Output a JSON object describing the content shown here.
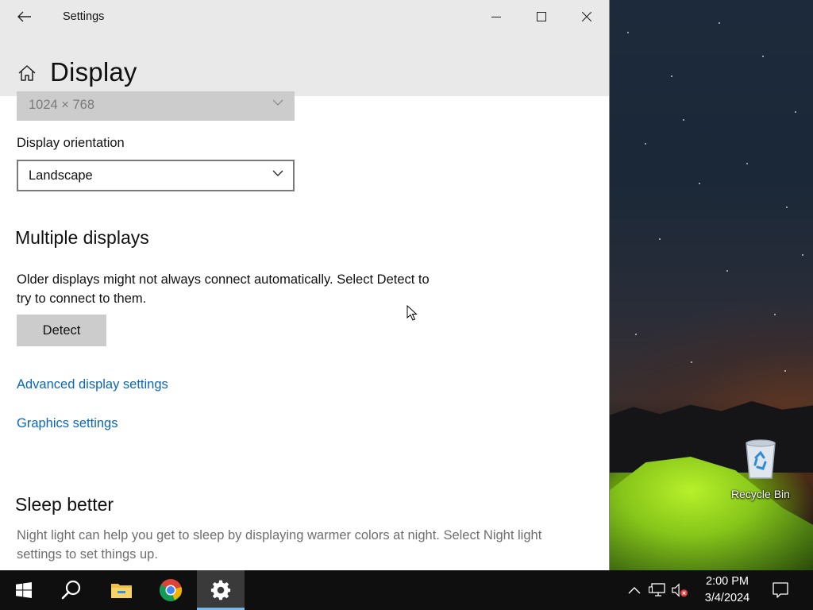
{
  "window": {
    "title": "Settings",
    "page_title": "Display"
  },
  "display": {
    "resolution_value": "1024 × 768",
    "orientation_label": "Display orientation",
    "orientation_value": "Landscape"
  },
  "multiple_displays": {
    "heading": "Multiple displays",
    "description_line1": "Older displays might not always connect automatically. Select Detect to",
    "description_line2": "try to connect to them.",
    "detect_label": "Detect",
    "advanced_link": "Advanced display settings",
    "graphics_link": "Graphics settings"
  },
  "sleep": {
    "heading": "Sleep better",
    "description_line1": "Night light can help you get to sleep by displaying warmer colors at night. Select Night light",
    "description_line2": "settings to set things up."
  },
  "desktop": {
    "recycle_bin_label": "Recycle Bin"
  },
  "taskbar": {
    "time": "2:00 PM",
    "date": "3/4/2024",
    "pinned": [
      "start-icon",
      "search-icon",
      "file-explorer-icon",
      "chrome-icon",
      "settings-gear-icon"
    ],
    "active_app": "settings-gear-icon"
  },
  "colors": {
    "link": "#0b66b8",
    "header_bg": "#e9e9e9",
    "taskbar_bg": "#0f0f0f",
    "accent": "#76b9ed"
  }
}
